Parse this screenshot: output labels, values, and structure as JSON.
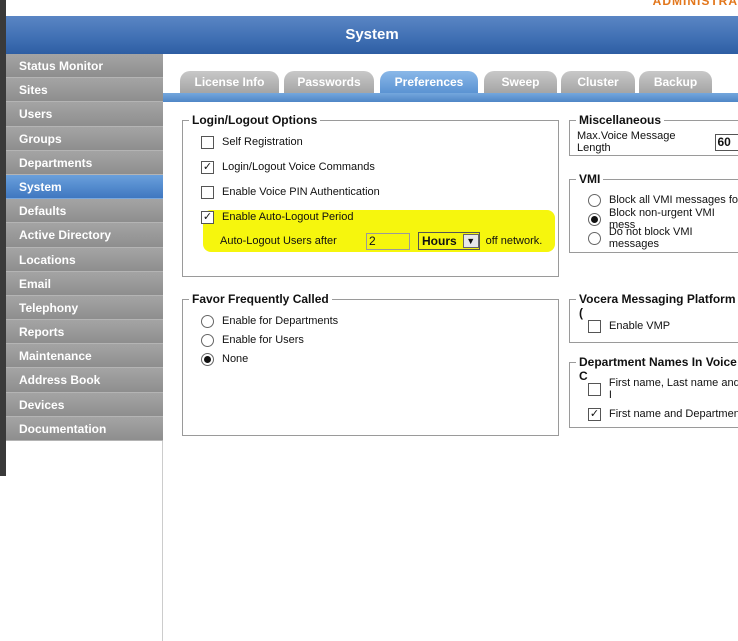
{
  "brand": "ADMINISTRA",
  "header": {
    "title": "System"
  },
  "sidebar": {
    "items": [
      {
        "label": "Status Monitor"
      },
      {
        "label": "Sites"
      },
      {
        "label": "Users"
      },
      {
        "label": "Groups"
      },
      {
        "label": "Departments"
      },
      {
        "label": "System",
        "active": true
      },
      {
        "label": "Defaults"
      },
      {
        "label": "Active Directory"
      },
      {
        "label": "Locations"
      },
      {
        "label": "Email"
      },
      {
        "label": "Telephony"
      },
      {
        "label": "Reports"
      },
      {
        "label": "Maintenance"
      },
      {
        "label": "Address Book"
      },
      {
        "label": "Devices"
      },
      {
        "label": "Documentation"
      }
    ]
  },
  "tabs": [
    {
      "label": "License Info"
    },
    {
      "label": "Passwords"
    },
    {
      "label": "Preferences",
      "active": true
    },
    {
      "label": "Sweep"
    },
    {
      "label": "Cluster"
    },
    {
      "label": "Backup"
    }
  ],
  "login_logout": {
    "legend": "Login/Logout Options",
    "self_registration": {
      "label": "Self Registration",
      "checked": false
    },
    "voice_commands": {
      "label": "Login/Logout Voice Commands",
      "checked": true
    },
    "voice_pin": {
      "label": "Enable Voice PIN Authentication",
      "checked": false
    },
    "auto_logout": {
      "label": "Enable Auto-Logout Period",
      "checked": true
    },
    "auto_logout_after_label": "Auto-Logout Users after",
    "auto_logout_value": "2",
    "auto_logout_unit": "Hours",
    "off_network_label": "off network."
  },
  "favor": {
    "legend": "Favor Frequently Called",
    "options": [
      {
        "label": "Enable for Departments",
        "selected": false
      },
      {
        "label": "Enable for Users",
        "selected": false
      },
      {
        "label": "None",
        "selected": true
      }
    ]
  },
  "misc": {
    "legend": "Miscellaneous",
    "max_voice_label": "Max.Voice Message Length",
    "max_voice_value": "60"
  },
  "vmi": {
    "legend": "VMI",
    "options": [
      {
        "label": "Block all VMI messages for",
        "selected": false
      },
      {
        "label": "Block non-urgent VMI mess",
        "selected": true
      },
      {
        "label": "Do not block VMI messages",
        "selected": false
      }
    ]
  },
  "vmp": {
    "legend": "Vocera Messaging Platform (",
    "enable_vmp": {
      "label": "Enable VMP",
      "checked": false
    }
  },
  "dept_names": {
    "legend": "Department Names In Voice C",
    "option1": {
      "label": "First name, Last name and I",
      "checked": false
    },
    "option2": {
      "label": "First name and Department",
      "checked": true
    }
  },
  "colors": {
    "accent_blue": "#4f86c6",
    "highlight": "#f5f500",
    "sidebar_gray": "#979797"
  }
}
